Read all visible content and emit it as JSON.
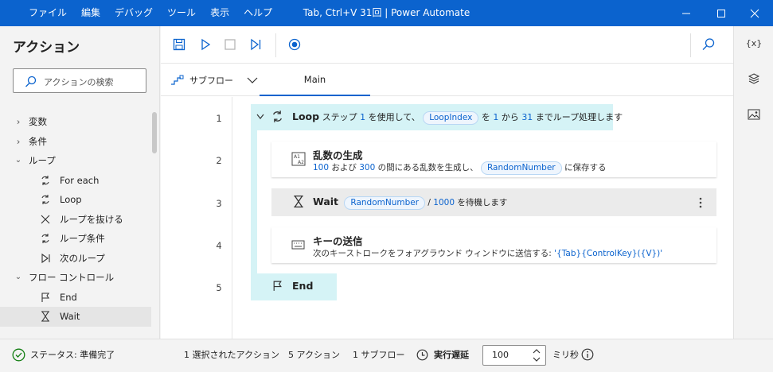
{
  "titlebar": {
    "menu": [
      "ファイル",
      "編集",
      "デバッグ",
      "ツール",
      "表示",
      "ヘルプ"
    ],
    "title": "Tab, Ctrl+V 31回 | Power Automate"
  },
  "actions_pane": {
    "title": "アクション",
    "search_placeholder": "アクションの検索",
    "tree": [
      {
        "label": "変数",
        "icon": "chevron-right-icon"
      },
      {
        "label": "条件",
        "icon": "chevron-right-icon"
      },
      {
        "label": "ループ",
        "icon": "chevron-down-icon"
      },
      {
        "label": "For each",
        "icon": "loop-icon"
      },
      {
        "label": "Loop",
        "icon": "loop-icon"
      },
      {
        "label": "ループを抜ける",
        "icon": "close-icon"
      },
      {
        "label": "ループ条件",
        "icon": "loop-icon"
      },
      {
        "label": "次のループ",
        "icon": "next-icon"
      },
      {
        "label": "フロー コントロール",
        "icon": "chevron-down-icon"
      },
      {
        "label": "End",
        "icon": "flag-icon"
      },
      {
        "label": "Wait",
        "icon": "hourglass-icon"
      }
    ]
  },
  "tabs": {
    "subflow": "サブフロー",
    "main": "Main"
  },
  "flow": {
    "line_numbers": [
      "1",
      "2",
      "3",
      "4",
      "5"
    ],
    "loop": {
      "title": "Loop",
      "t1": "ステップ",
      "step": "1",
      "t2": "を使用して、",
      "var": "LoopIndex",
      "t3": "を",
      "from": "1",
      "t4": "から",
      "to": "31",
      "t5": "までループ処理します"
    },
    "random": {
      "title": "乱数の生成",
      "min": "100",
      "t1": "および",
      "max": "300",
      "t2": "の間にある乱数を生成し、",
      "var": "RandomNumber",
      "t3": "に保存する"
    },
    "wait": {
      "title": "Wait",
      "var": "RandomNumber",
      "t1": "/",
      "div": "1000",
      "t2": "を待機します"
    },
    "sendkeys": {
      "title": "キーの送信",
      "desc": "次のキーストロークをフォアグラウンド ウィンドウに送信する:",
      "keys": "'{Tab}{ControlKey}({V})'"
    },
    "end": {
      "title": "End"
    }
  },
  "right_pane": {
    "variables_label": "{x}"
  },
  "status": {
    "state": "ステータス: 準備完了",
    "selected": "1 選択されたアクション",
    "actions": "5 アクション",
    "subflows": "1 サブフロー",
    "delay_label": "実行遅延",
    "delay_value": "100",
    "unit": "ミリ秒"
  },
  "colors": {
    "accent": "#0b63ce",
    "loop_bg": "#d5f3f6",
    "status_ok": "#107c10"
  }
}
